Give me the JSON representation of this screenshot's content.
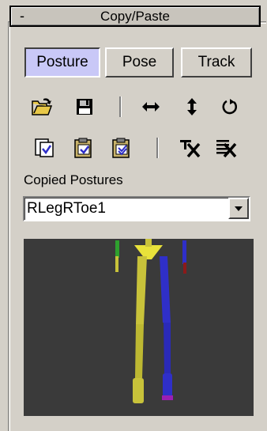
{
  "rollout": {
    "title": "Copy/Paste",
    "collapse_symbol": "-"
  },
  "tabs": [
    {
      "label": "Posture",
      "active": true
    },
    {
      "label": "Pose",
      "active": false
    },
    {
      "label": "Track",
      "active": false
    }
  ],
  "toolbar_row1": [
    "open-folder-icon",
    "save-disk-icon",
    "mirror-horizontal-icon",
    "mirror-vertical-icon",
    "rotate-icon"
  ],
  "toolbar_row2": [
    "copy-posture-icon",
    "paste-posture-icon",
    "paste-opposite-icon",
    "delete-selected-icon",
    "delete-all-icon"
  ],
  "copied": {
    "label": "Copied Postures",
    "selected": "RLegRToe1"
  },
  "viewport": {
    "background": "#3a3a3a",
    "left_leg_color": "#c8c23a",
    "right_leg_color": "#2f2fc8"
  }
}
